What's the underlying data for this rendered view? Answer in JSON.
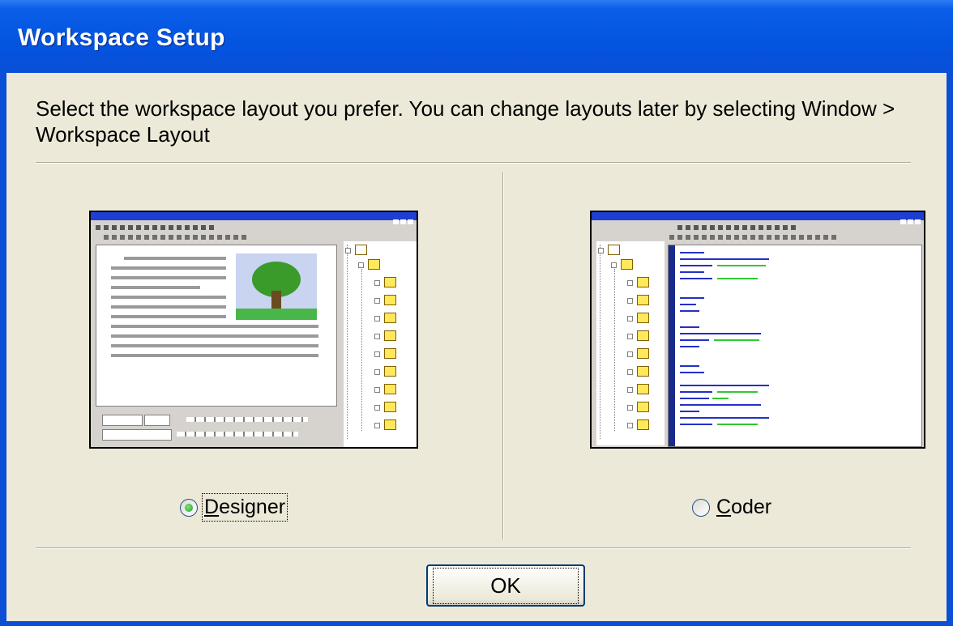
{
  "window": {
    "title": "Workspace Setup",
    "instruction": "Select the workspace layout you prefer. You can change layouts later by selecting Window > Workspace Layout"
  },
  "options": [
    {
      "label_mnemonic": "D",
      "label_rest": "esigner",
      "selected": true,
      "preview_icon": "designer-layout-preview"
    },
    {
      "label_mnemonic": "C",
      "label_rest": "oder",
      "selected": false,
      "preview_icon": "coder-layout-preview"
    }
  ],
  "buttons": {
    "ok_label": "OK"
  },
  "colors": {
    "titlebar": "#0a4fd6",
    "dialog_bg": "#ece9d8",
    "radio_dot": "#21a121"
  }
}
